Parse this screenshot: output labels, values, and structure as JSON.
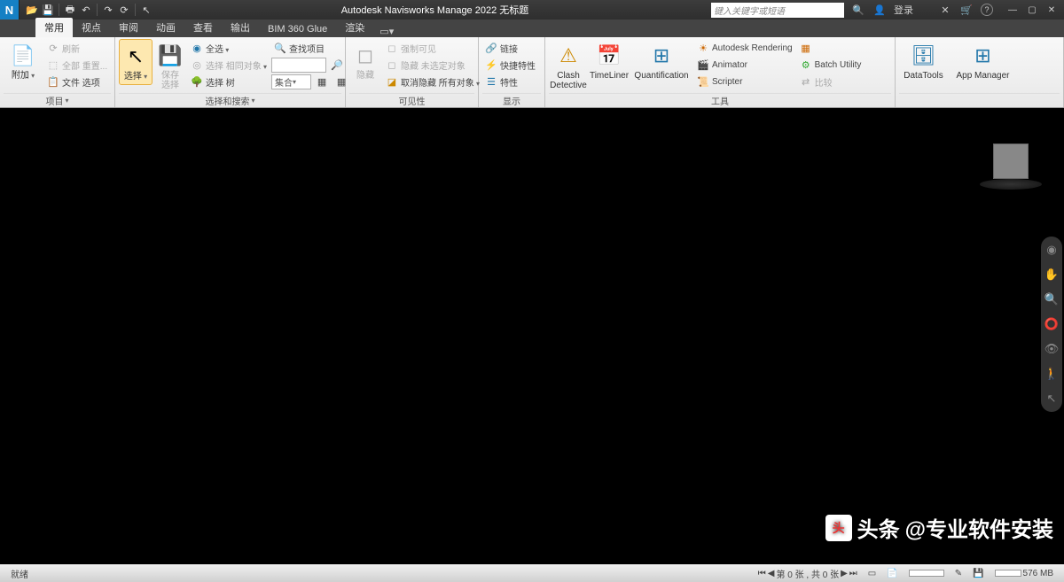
{
  "titlebar": {
    "app_logo": "N",
    "title": "Autodesk Navisworks Manage 2022   无标题",
    "search_placeholder": "键入关键字或短语",
    "login": "登录"
  },
  "tabs": {
    "items": [
      "常用",
      "视点",
      "审阅",
      "动画",
      "查看",
      "输出",
      "BIM 360 Glue",
      "渲染"
    ],
    "active": 0
  },
  "ribbon": {
    "panels": [
      {
        "title": "项目",
        "drop": true
      },
      {
        "title": "选择和搜索",
        "drop": true
      },
      {
        "title": "可见性"
      },
      {
        "title": "显示"
      },
      {
        "title": "工具"
      },
      {
        "title": ""
      }
    ],
    "p0": {
      "append": "附加",
      "refresh": "刷新",
      "reset": "全部 重置...",
      "options": "文件 选项"
    },
    "p1": {
      "select": "选择",
      "save": "保存\n选择",
      "all": "全选",
      "same": "选择 相同对象",
      "tree": "选择 树",
      "find": "查找项目",
      "sets": "集合"
    },
    "p2": {
      "hide": "隐藏",
      "force": "强制可见",
      "hide_unsel": "隐藏 未选定对象",
      "unhide": "取消隐藏 所有对象"
    },
    "p3": {
      "links": "链接",
      "qprops": "快捷特性",
      "props": "特性"
    },
    "p4": {
      "clash": "Clash\nDetective",
      "tl": "TimeLiner",
      "quant": "Quantification",
      "render": "Autodesk Rendering",
      "anim": "Animator",
      "script": "Scripter",
      "batch": "Batch Utility",
      "compare": "比较"
    },
    "p5": {
      "dt": "DataTools",
      "am": "App Manager"
    }
  },
  "statusbar": {
    "ready": "就绪",
    "sheets": "第 0 张 , 共 0 张",
    "mem": "576 MB"
  },
  "watermark": {
    "brand": "头条",
    "handle": "@专业软件安装"
  }
}
